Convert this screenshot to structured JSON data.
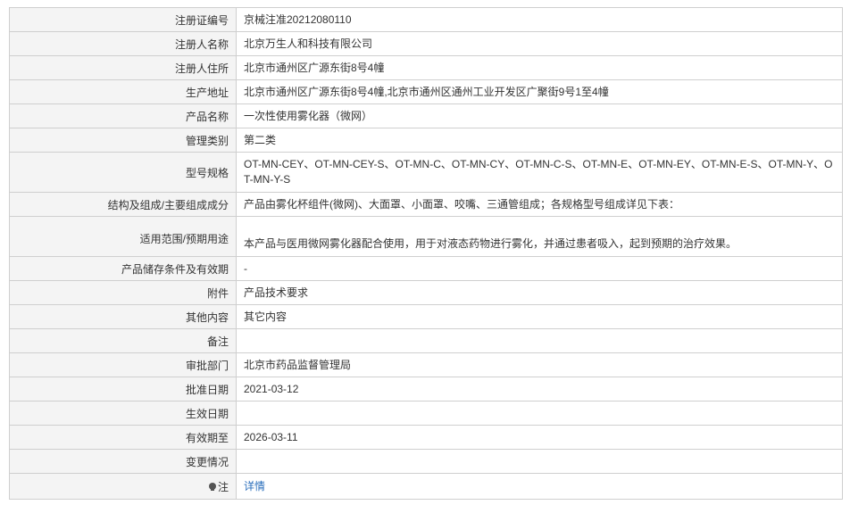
{
  "rows": [
    {
      "label": "注册证编号",
      "value": "京械注准20212080110"
    },
    {
      "label": "注册人名称",
      "value": "北京万生人和科技有限公司"
    },
    {
      "label": "注册人住所",
      "value": "北京市通州区广源东街8号4幢"
    },
    {
      "label": "生产地址",
      "value": "北京市通州区广源东街8号4幢,北京市通州区通州工业开发区广聚街9号1至4幢"
    },
    {
      "label": "产品名称",
      "value": "一次性使用雾化器（微网）"
    },
    {
      "label": "管理类别",
      "value": "第二类"
    },
    {
      "label": "型号规格",
      "value": "OT-MN-CEY、OT-MN-CEY-S、OT-MN-C、OT-MN-CY、OT-MN-C-S、OT-MN-E、OT-MN-EY、OT-MN-E-S、OT-MN-Y、OT-MN-Y-S"
    },
    {
      "label": "结构及组成/主要组成成分",
      "value": "产品由雾化杯组件(微网)、大面罩、小面罩、咬嘴、三通管组成；各规格型号组成详见下表："
    },
    {
      "label": "适用范围/预期用途",
      "value": "本产品与医用微网雾化器配合使用，用于对液态药物进行雾化，并通过患者吸入，起到预期的治疗效果。"
    },
    {
      "label": "产品储存条件及有效期",
      "value": "-"
    },
    {
      "label": "附件",
      "value": "产品技术要求"
    },
    {
      "label": "其他内容",
      "value": "其它内容"
    },
    {
      "label": "备注",
      "value": ""
    },
    {
      "label": "审批部门",
      "value": "北京市药品监督管理局"
    },
    {
      "label": "批准日期",
      "value": "2021-03-12"
    },
    {
      "label": "生效日期",
      "value": ""
    },
    {
      "label": "有效期至",
      "value": "2026-03-11"
    },
    {
      "label": "变更情况",
      "value": ""
    }
  ],
  "note": {
    "label": "注",
    "link": "详情",
    "icon": "lightbulb-icon"
  }
}
